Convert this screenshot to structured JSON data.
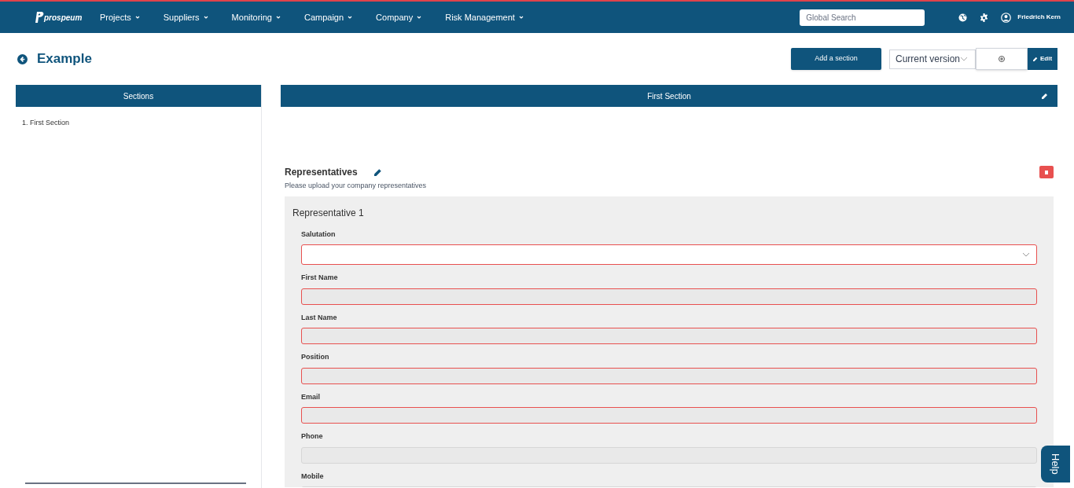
{
  "nav": {
    "logo": "prospeum",
    "menu": [
      {
        "label": "Projects"
      },
      {
        "label": "Suppliers"
      },
      {
        "label": "Monitoring"
      },
      {
        "label": "Campaign"
      },
      {
        "label": "Company"
      },
      {
        "label": "Risk Management"
      }
    ],
    "search": {
      "placeholder": "Global Search"
    },
    "user": "Friedrich Kern"
  },
  "page": {
    "title": "Example",
    "add_button": "Add a section",
    "version": "Current version",
    "edit_button": "Edit"
  },
  "sidebar": {
    "header": "Sections",
    "items": [
      {
        "label": "1. First Section",
        "selected": false
      }
    ]
  },
  "section": {
    "header": "First Section",
    "block": {
      "title": "Representatives",
      "description": "Please upload your company representatives",
      "card_title": "Representative 1",
      "fields": [
        {
          "label": "Salutation",
          "kind": "select",
          "invalid": true
        },
        {
          "label": "First Name",
          "kind": "text",
          "invalid": true
        },
        {
          "label": "Last Name",
          "kind": "text",
          "invalid": true
        },
        {
          "label": "Position",
          "kind": "text",
          "invalid": true
        },
        {
          "label": "Email",
          "kind": "text",
          "invalid": true
        },
        {
          "label": "Phone",
          "kind": "text",
          "invalid": false
        },
        {
          "label": "Mobile",
          "kind": "text",
          "invalid": false
        }
      ]
    }
  },
  "help": "Help"
}
